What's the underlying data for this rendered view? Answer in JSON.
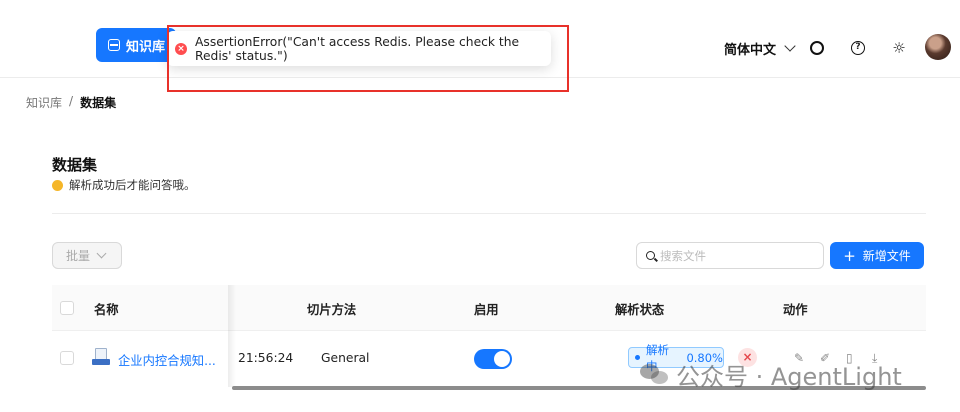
{
  "header": {
    "kb_button_label": "知识库",
    "language_label": "简体中文",
    "icons": [
      "github-icon",
      "help-icon",
      "sun-icon",
      "avatar"
    ]
  },
  "toast": {
    "message": "AssertionError(\"Can't access Redis. Please check the Redis' status.\")",
    "type": "error"
  },
  "breadcrumb": {
    "parent": "知识库",
    "separator": "/",
    "current": "数据集"
  },
  "page": {
    "title": "数据集",
    "hint": "解析成功后才能问答哦。"
  },
  "toolbar": {
    "batch_label": "批量",
    "search_placeholder": "搜索文件",
    "add_label": "新增文件"
  },
  "table": {
    "columns": {
      "name": "名称",
      "chunk_method": "切片方法",
      "enabled": "启用",
      "parse_status": "解析状态",
      "action": "动作"
    },
    "rows": [
      {
        "name": "企业内控合规知...",
        "time": "21:56:24",
        "chunk_method": "General",
        "enabled": true,
        "status": "解析中",
        "progress": "0.80%"
      }
    ]
  },
  "watermark": {
    "text": "公众号 · AgentLight"
  },
  "colors": {
    "primary": "#1677ff",
    "error": "#ff4d4f",
    "highlight_box": "#e8312a"
  }
}
